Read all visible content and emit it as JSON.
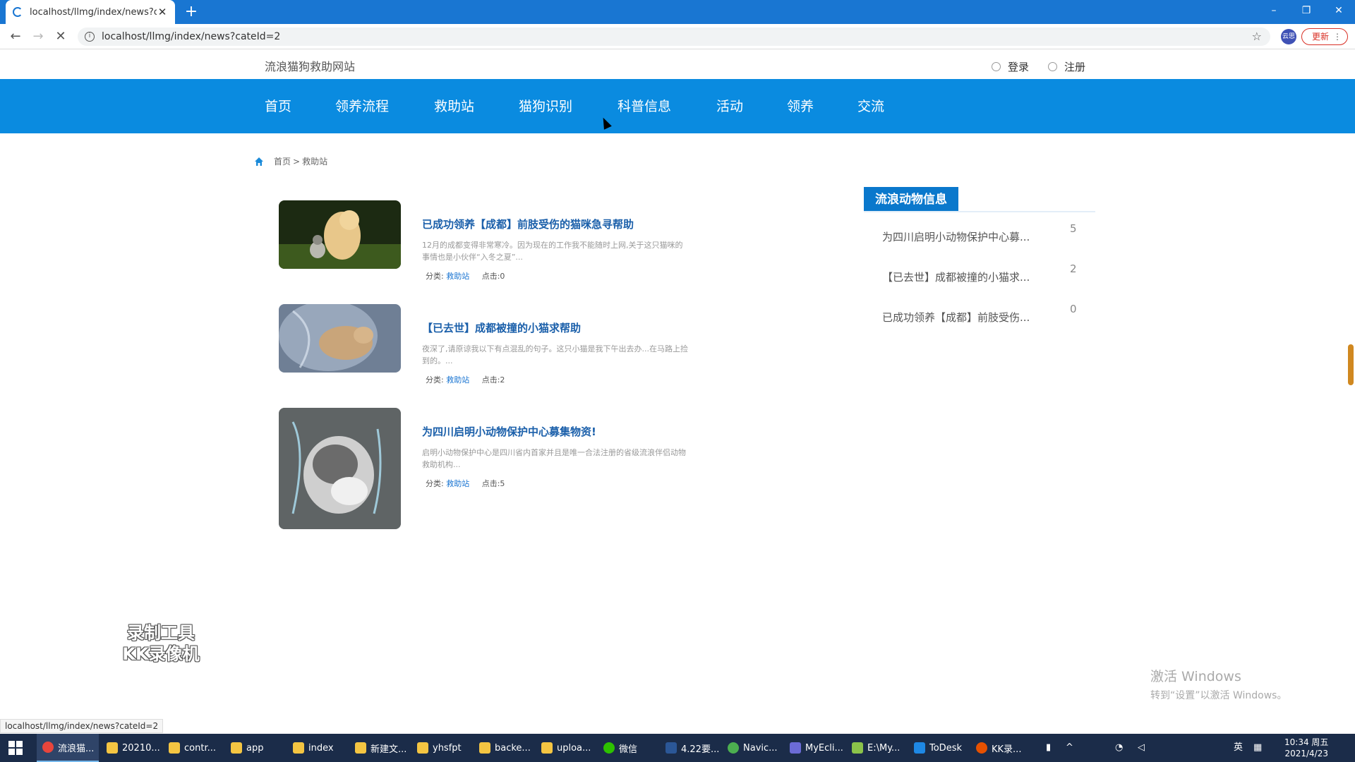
{
  "browser": {
    "tab_title": "localhost/llmg/index/news?cat",
    "new_tab": "+",
    "url": "localhost/llmg/index/news?cateId=2",
    "profile_label": "云思",
    "update_label": "更新",
    "status_url": "localhost/llmg/index/news?cateId=2",
    "win_minimize": "–",
    "win_restore": "❐",
    "win_close": "✕"
  },
  "header": {
    "site_name": "流浪猫狗救助网站",
    "login": "登录",
    "register": "注册"
  },
  "nav": [
    {
      "label": "首页"
    },
    {
      "label": "领养流程"
    },
    {
      "label": "救助站"
    },
    {
      "label": "猫狗识别"
    },
    {
      "label": "科普信息"
    },
    {
      "label": "活动"
    },
    {
      "label": "领养"
    },
    {
      "label": "交流"
    }
  ],
  "breadcrumb": {
    "home": "首页",
    "separator": ">",
    "current": "救助站"
  },
  "news": [
    {
      "title": "已成功领养【成都】前肢受伤的猫咪急寻帮助",
      "desc": "12月的成都变得非常寒冷。因为现在的工作我不能随时上网,关于这只猫咪的事情也是小伙伴“入冬之夏”...",
      "category_label": "分类:",
      "category": "救助站",
      "clicks": "点击:0",
      "image": "puppy-and-kitten-on-grass"
    },
    {
      "title": "【已去世】成都被撞的小猫求帮助",
      "desc": "夜深了,请原谅我以下有点混乱的句子。这只小猫是我下午出去办...在马路上捡到的。...",
      "category_label": "分类:",
      "category": "救助站",
      "clicks": "点击:2",
      "image": "injured-kitten-in-bag"
    },
    {
      "title": "为四川启明小动物保护中心募集物资!",
      "desc": "启明小动物保护中心是四川省内首家并且是唯一合法注册的省级流浪伴侣动物救助机构...",
      "category_label": "分类:",
      "category": "救助站",
      "clicks": "点击:5",
      "image": "kitten-artwork"
    }
  ],
  "sidebar": {
    "heading": "流浪动物信息",
    "items": [
      {
        "title": "为四川启明小动物保护中心募...",
        "count": "5"
      },
      {
        "title": "【已去世】成都被撞的小猫求...",
        "count": "2"
      },
      {
        "title": "已成功领养【成都】前肢受伤...",
        "count": "0"
      }
    ]
  },
  "overlay": {
    "watermark_line1": "录制工具",
    "watermark_line2": "KK录像机",
    "activate_title": "激活 Windows",
    "activate_sub": "转到“设置”以激活 Windows。"
  },
  "taskbar": {
    "items": [
      {
        "label": "流浪猫...",
        "icon": "chrome-icon",
        "color": "#e8453c"
      },
      {
        "label": "20210...",
        "icon": "folder-icon",
        "color": "#f4c542"
      },
      {
        "label": "contr...",
        "icon": "folder-icon",
        "color": "#f4c542"
      },
      {
        "label": "app",
        "icon": "folder-icon",
        "color": "#f4c542"
      },
      {
        "label": "index",
        "icon": "folder-icon",
        "color": "#f4c542"
      },
      {
        "label": "新建文...",
        "icon": "folder-icon",
        "color": "#f4c542"
      },
      {
        "label": "yhsfpt",
        "icon": "folder-icon",
        "color": "#f4c542"
      },
      {
        "label": "backe...",
        "icon": "folder-icon",
        "color": "#f4c542"
      },
      {
        "label": "uploa...",
        "icon": "folder-icon",
        "color": "#f4c542"
      },
      {
        "label": "微信",
        "icon": "wechat-icon",
        "color": "#2dc100"
      },
      {
        "label": "4.22要...",
        "icon": "word-icon",
        "color": "#2b5797"
      },
      {
        "label": "Navic...",
        "icon": "navicat-icon",
        "color": "#4caf50"
      },
      {
        "label": "MyEcli...",
        "icon": "myeclipse-icon",
        "color": "#6b6bd6"
      },
      {
        "label": "E:\\My...",
        "icon": "notepad-icon",
        "color": "#8bc34a"
      },
      {
        "label": "ToDesk",
        "icon": "todesk-icon",
        "color": "#1e88e5"
      },
      {
        "label": "KK录...",
        "icon": "kk-recorder-icon",
        "color": "#e65100"
      }
    ],
    "ime": "英",
    "time": "10:34 周五",
    "date": "2021/4/23"
  }
}
